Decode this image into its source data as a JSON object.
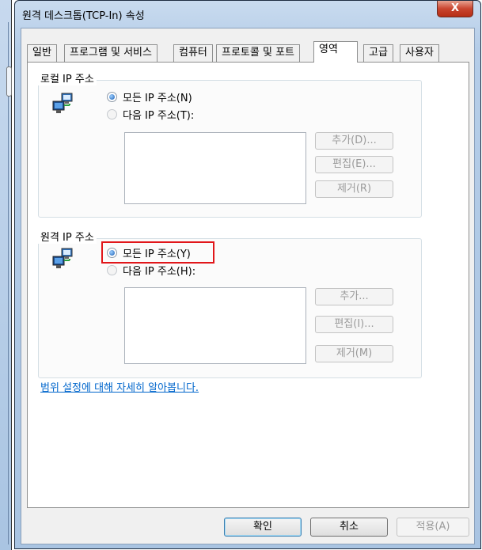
{
  "window": {
    "title": "원격 데스크톱(TCP-In) 속성",
    "close_glyph": "X"
  },
  "tabs": [
    {
      "label": "일반"
    },
    {
      "label": "프로그램 및 서비스"
    },
    {
      "label": "컴퓨터"
    },
    {
      "label": "프로토콜 및 포트"
    },
    {
      "label": "영역"
    },
    {
      "label": "고급"
    },
    {
      "label": "사용자"
    }
  ],
  "active_tab": "영역",
  "local_ip": {
    "group_label": "로컬 IP 주소",
    "icon": "network-computers-icon",
    "option_any": "모든 IP 주소(N)",
    "option_these": "다음 IP 주소(T):",
    "selected": "any",
    "add_button": "추가(D)...",
    "edit_button": "편집(E)...",
    "remove_button": "제거(R)"
  },
  "remote_ip": {
    "group_label": "원격 IP 주소",
    "icon": "network-computers-icon",
    "option_any": "모든 IP 주소(Y)",
    "option_these": "다음 IP 주소(H):",
    "selected": "any",
    "add_button": "추가...",
    "edit_button": "편집(I)...",
    "remove_button": "제거(M)"
  },
  "help_link": "범위 설정에 대해 자세히 알아봅니다.",
  "footer": {
    "ok": "확인",
    "cancel": "취소",
    "apply": "적용(A)"
  },
  "colors": {
    "highlight_border": "#e1161a",
    "link": "#0066cc",
    "title_gradient_top": "#c9dbef"
  }
}
